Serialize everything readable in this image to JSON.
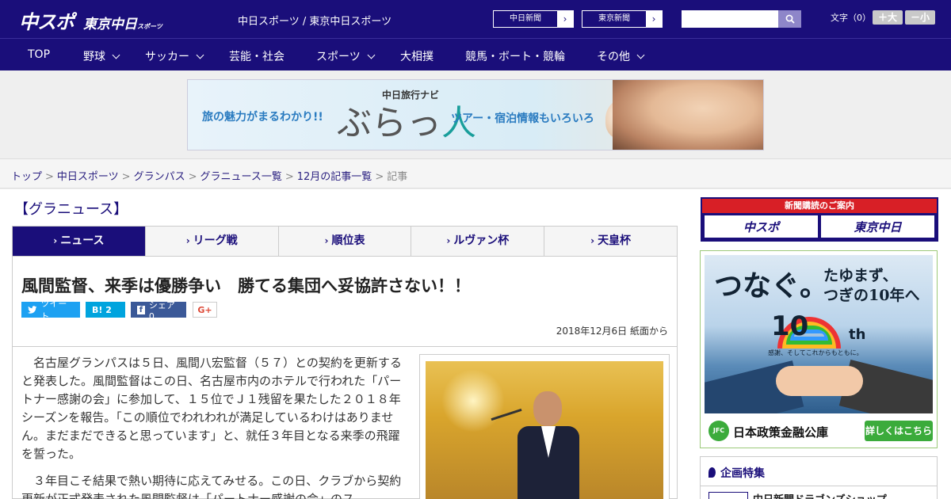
{
  "header": {
    "logo_main": "中スポ",
    "logo_sub": "東京中日",
    "logo_sub_small": "スポーツ",
    "site_names": "中日スポーツ / 東京中日スポーツ",
    "paper_buttons": [
      "中日新聞",
      "東京新聞"
    ],
    "search_placeholder": "",
    "fontsize_label": "文字（0）",
    "font_larger": "＋大",
    "font_smaller": "－小"
  },
  "nav": {
    "items": [
      "TOP",
      "野球",
      "サッカー",
      "芸能・社会",
      "スポーツ",
      "大相撲",
      "競馬・ボート・競輪",
      "その他"
    ]
  },
  "banner": {
    "left_text": "旅の魅力がまるわかり!!",
    "brand_small": "中日旅行ナビ",
    "brand_big_1": "ぶらっ",
    "brand_big_2": "人",
    "right_text": "ツアー・宿泊情報もいろいろ"
  },
  "breadcrumb": {
    "links": [
      "トップ",
      "中日スポーツ",
      "グランパス",
      "グラニュース一覧",
      "12月の記事一覧"
    ],
    "current": "記事",
    "separator": ">"
  },
  "section_title": "【グラニュース】",
  "tabs": [
    "ニュース",
    "リーグ戦",
    "順位表",
    "ルヴァン杯",
    "天皇杯"
  ],
  "article": {
    "headline": "風間監督、来季は優勝争い　勝てる集団へ妥協許さない！！",
    "share": {
      "tweet": "ツイート",
      "hatena": "B! 2",
      "facebook": "シェア 0",
      "gplus": "G+"
    },
    "date": "2018年12月6日 紙面から",
    "paragraphs": [
      "名古屋グランパスは５日、風間八宏監督（５７）との契約を更新すると発表した。風間監督はこの日、名古屋市内のホテルで行われた「パートナー感謝の会」に参加して、１５位でＪ１残留を果たした２０１８年シーズンを報告。「この順位でわれわれが満足しているわけはありません。まだまだできると思っています」と、就任３年目となる来季の飛躍を誓った。",
      "３年目こそ結果で熱い期待に応えてみせる。この日、クラブから契約更新が正式発表された風間監督は「パートナー感謝の会」のス"
    ]
  },
  "sidebar": {
    "subscribe_head": "新聞購読のご案内",
    "subscribe_logos": [
      "中スポ",
      "東京中日"
    ],
    "ad": {
      "headline": "つなぐ。",
      "sub_line1": "たゆまず、",
      "sub_line2": "つぎの10年へ",
      "ten": "10",
      "th": "th",
      "tagline": "感謝、そしてこれからもともに。",
      "jfc": "JFC",
      "org": "日本政策金融公庫",
      "more": "詳しくはこちら ▸"
    },
    "feature_title": "企画特集",
    "feature_item": "中日新聞ドラゴンズショップ"
  }
}
